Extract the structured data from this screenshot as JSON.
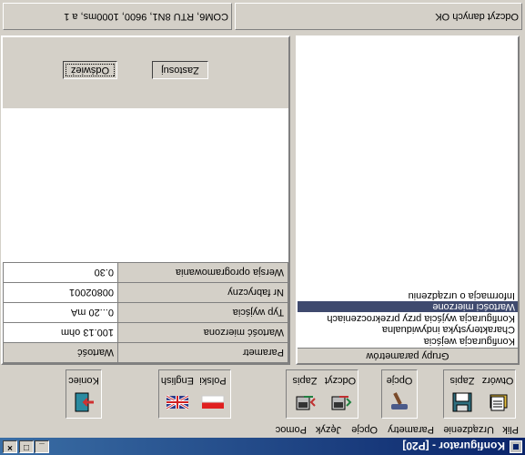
{
  "window": {
    "title": "Konfigurator - [P20]",
    "minimize": "_",
    "maximize": "□",
    "close": "×"
  },
  "menu": [
    "Plik",
    "Urządzenie",
    "Parametry",
    "Opcje",
    "Język",
    "Pomoc"
  ],
  "toolbar": {
    "open": "Otwórz",
    "save": "Zapis",
    "options": "Opcje",
    "read": "Odczyt",
    "write": "Zapis",
    "polish": "Polski",
    "english": "English",
    "exit": "Koniec"
  },
  "groups_panel": {
    "header": "Grupy parametrów",
    "items": [
      "Konfiguracja wejścia",
      "Charakterystyka indywidualna",
      "Konfiguracja wyjścia przy przekroczeniach",
      "Wartości mierzone",
      "Informacja o urządzeniu"
    ],
    "selected": "Wartości mierzone"
  },
  "params_table": {
    "columns": [
      "Parametr",
      "Wartość"
    ],
    "rows": [
      {
        "name": "Wartość mierzona",
        "value": "100.13 ohm"
      },
      {
        "name": "Typ wyjścia",
        "value": "0...20 mA"
      },
      {
        "name": "Nr fabryczny",
        "value": "00802001"
      },
      {
        "name": "Wersja oprogramowania",
        "value": "0.30"
      }
    ]
  },
  "actions": {
    "refresh": "Odśwież",
    "apply": "Zastosuj"
  },
  "status": {
    "connection": "COM6, RTU 8N1, 9600, 1000ms, a 1",
    "message": "Odczyt danych OK"
  },
  "colors": {
    "selection": "#3f4a6e",
    "titlebar": "#0a246a",
    "face": "#d4d0c8"
  }
}
